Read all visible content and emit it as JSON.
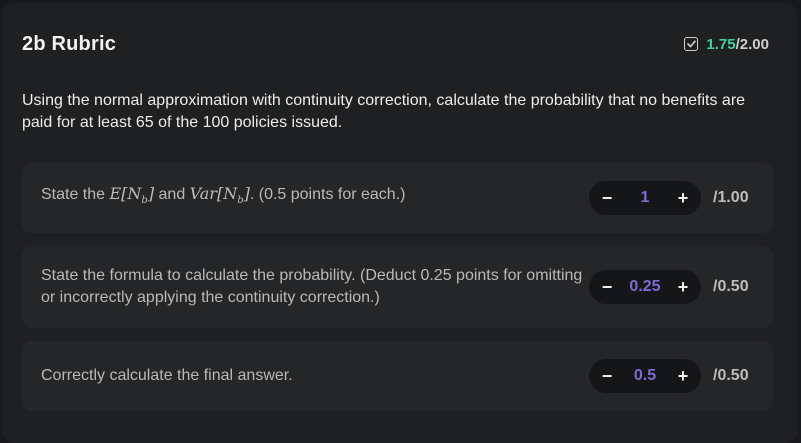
{
  "header": {
    "title": "2b Rubric",
    "earned": "1.75",
    "total": "/2.00"
  },
  "prompt": "Using the normal approximation with continuity correction, calculate the probability that no benefits are paid for at least 65 of the 100 policies issued.",
  "criteria": [
    {
      "text_a": "State the ",
      "math_e": "E[N",
      "math_sub": "b",
      "math_close": "]",
      "text_and": " and ",
      "math_var": "Var[N",
      "math_sub2": "b",
      "math_close2": "]",
      "text_b": ". (0.5 points for each.)",
      "value": "1",
      "max": "/1.00"
    },
    {
      "text": "State the formula to calculate the probability. (Deduct 0.25 points for omitting or incorrectly applying the continuity correction.)",
      "value": "0.25",
      "max": "/0.50"
    },
    {
      "text": "Correctly calculate the final answer.",
      "value": "0.5",
      "max": "/0.50"
    }
  ],
  "stepper": {
    "minus": "−",
    "plus": "+"
  },
  "colors": {
    "earned": "#3fd39a",
    "value": "#7d6bd6",
    "background": "#1f2022",
    "card": "#252628"
  },
  "icons": {
    "score": "checkbox-check-icon"
  }
}
